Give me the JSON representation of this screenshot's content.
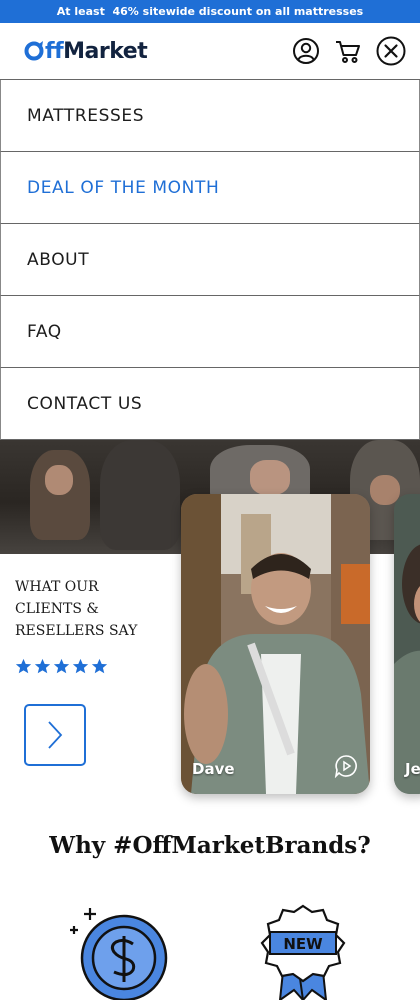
{
  "promo": {
    "text": "At least  46% sitewide discount on all mattresses"
  },
  "header": {
    "logo_prefix": "ff",
    "logo_suffix": "Market",
    "icons": [
      "account-icon",
      "cart-icon",
      "close-icon"
    ]
  },
  "menu": {
    "items": [
      {
        "label": "MATTRESSES"
      },
      {
        "label": "DEAL OF THE MONTH",
        "active": true
      },
      {
        "label": "ABOUT"
      },
      {
        "label": "FAQ"
      },
      {
        "label": "CONTACT US"
      }
    ]
  },
  "testimonials": {
    "title": "WHAT OUR CLIENTS & RESELLERS SAY",
    "rating": 5,
    "cards": [
      {
        "name": "Dave"
      },
      {
        "name": "Jen"
      }
    ]
  },
  "why": {
    "title": "Why #OffMarketBrands?",
    "badge_text": "NEW"
  },
  "colors": {
    "accent": "#1f6fd6",
    "navy": "#12233f"
  }
}
